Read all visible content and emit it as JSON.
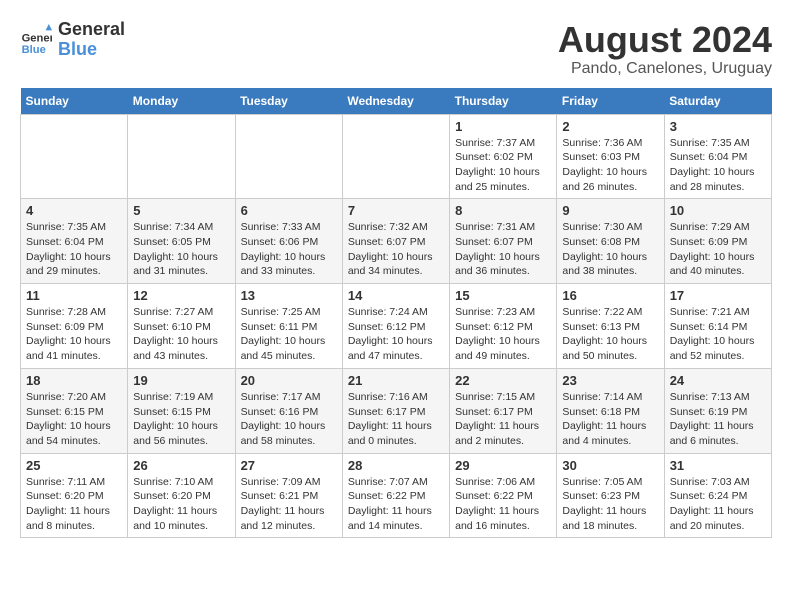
{
  "header": {
    "logo_line1": "General",
    "logo_line2": "Blue",
    "month_year": "August 2024",
    "location": "Pando, Canelones, Uruguay"
  },
  "weekdays": [
    "Sunday",
    "Monday",
    "Tuesday",
    "Wednesday",
    "Thursday",
    "Friday",
    "Saturday"
  ],
  "weeks": [
    [
      {
        "day": "",
        "info": ""
      },
      {
        "day": "",
        "info": ""
      },
      {
        "day": "",
        "info": ""
      },
      {
        "day": "",
        "info": ""
      },
      {
        "day": "1",
        "info": "Sunrise: 7:37 AM\nSunset: 6:02 PM\nDaylight: 10 hours and 25 minutes."
      },
      {
        "day": "2",
        "info": "Sunrise: 7:36 AM\nSunset: 6:03 PM\nDaylight: 10 hours and 26 minutes."
      },
      {
        "day": "3",
        "info": "Sunrise: 7:35 AM\nSunset: 6:04 PM\nDaylight: 10 hours and 28 minutes."
      }
    ],
    [
      {
        "day": "4",
        "info": "Sunrise: 7:35 AM\nSunset: 6:04 PM\nDaylight: 10 hours and 29 minutes."
      },
      {
        "day": "5",
        "info": "Sunrise: 7:34 AM\nSunset: 6:05 PM\nDaylight: 10 hours and 31 minutes."
      },
      {
        "day": "6",
        "info": "Sunrise: 7:33 AM\nSunset: 6:06 PM\nDaylight: 10 hours and 33 minutes."
      },
      {
        "day": "7",
        "info": "Sunrise: 7:32 AM\nSunset: 6:07 PM\nDaylight: 10 hours and 34 minutes."
      },
      {
        "day": "8",
        "info": "Sunrise: 7:31 AM\nSunset: 6:07 PM\nDaylight: 10 hours and 36 minutes."
      },
      {
        "day": "9",
        "info": "Sunrise: 7:30 AM\nSunset: 6:08 PM\nDaylight: 10 hours and 38 minutes."
      },
      {
        "day": "10",
        "info": "Sunrise: 7:29 AM\nSunset: 6:09 PM\nDaylight: 10 hours and 40 minutes."
      }
    ],
    [
      {
        "day": "11",
        "info": "Sunrise: 7:28 AM\nSunset: 6:09 PM\nDaylight: 10 hours and 41 minutes."
      },
      {
        "day": "12",
        "info": "Sunrise: 7:27 AM\nSunset: 6:10 PM\nDaylight: 10 hours and 43 minutes."
      },
      {
        "day": "13",
        "info": "Sunrise: 7:25 AM\nSunset: 6:11 PM\nDaylight: 10 hours and 45 minutes."
      },
      {
        "day": "14",
        "info": "Sunrise: 7:24 AM\nSunset: 6:12 PM\nDaylight: 10 hours and 47 minutes."
      },
      {
        "day": "15",
        "info": "Sunrise: 7:23 AM\nSunset: 6:12 PM\nDaylight: 10 hours and 49 minutes."
      },
      {
        "day": "16",
        "info": "Sunrise: 7:22 AM\nSunset: 6:13 PM\nDaylight: 10 hours and 50 minutes."
      },
      {
        "day": "17",
        "info": "Sunrise: 7:21 AM\nSunset: 6:14 PM\nDaylight: 10 hours and 52 minutes."
      }
    ],
    [
      {
        "day": "18",
        "info": "Sunrise: 7:20 AM\nSunset: 6:15 PM\nDaylight: 10 hours and 54 minutes."
      },
      {
        "day": "19",
        "info": "Sunrise: 7:19 AM\nSunset: 6:15 PM\nDaylight: 10 hours and 56 minutes."
      },
      {
        "day": "20",
        "info": "Sunrise: 7:17 AM\nSunset: 6:16 PM\nDaylight: 10 hours and 58 minutes."
      },
      {
        "day": "21",
        "info": "Sunrise: 7:16 AM\nSunset: 6:17 PM\nDaylight: 11 hours and 0 minutes."
      },
      {
        "day": "22",
        "info": "Sunrise: 7:15 AM\nSunset: 6:17 PM\nDaylight: 11 hours and 2 minutes."
      },
      {
        "day": "23",
        "info": "Sunrise: 7:14 AM\nSunset: 6:18 PM\nDaylight: 11 hours and 4 minutes."
      },
      {
        "day": "24",
        "info": "Sunrise: 7:13 AM\nSunset: 6:19 PM\nDaylight: 11 hours and 6 minutes."
      }
    ],
    [
      {
        "day": "25",
        "info": "Sunrise: 7:11 AM\nSunset: 6:20 PM\nDaylight: 11 hours and 8 minutes."
      },
      {
        "day": "26",
        "info": "Sunrise: 7:10 AM\nSunset: 6:20 PM\nDaylight: 11 hours and 10 minutes."
      },
      {
        "day": "27",
        "info": "Sunrise: 7:09 AM\nSunset: 6:21 PM\nDaylight: 11 hours and 12 minutes."
      },
      {
        "day": "28",
        "info": "Sunrise: 7:07 AM\nSunset: 6:22 PM\nDaylight: 11 hours and 14 minutes."
      },
      {
        "day": "29",
        "info": "Sunrise: 7:06 AM\nSunset: 6:22 PM\nDaylight: 11 hours and 16 minutes."
      },
      {
        "day": "30",
        "info": "Sunrise: 7:05 AM\nSunset: 6:23 PM\nDaylight: 11 hours and 18 minutes."
      },
      {
        "day": "31",
        "info": "Sunrise: 7:03 AM\nSunset: 6:24 PM\nDaylight: 11 hours and 20 minutes."
      }
    ]
  ]
}
